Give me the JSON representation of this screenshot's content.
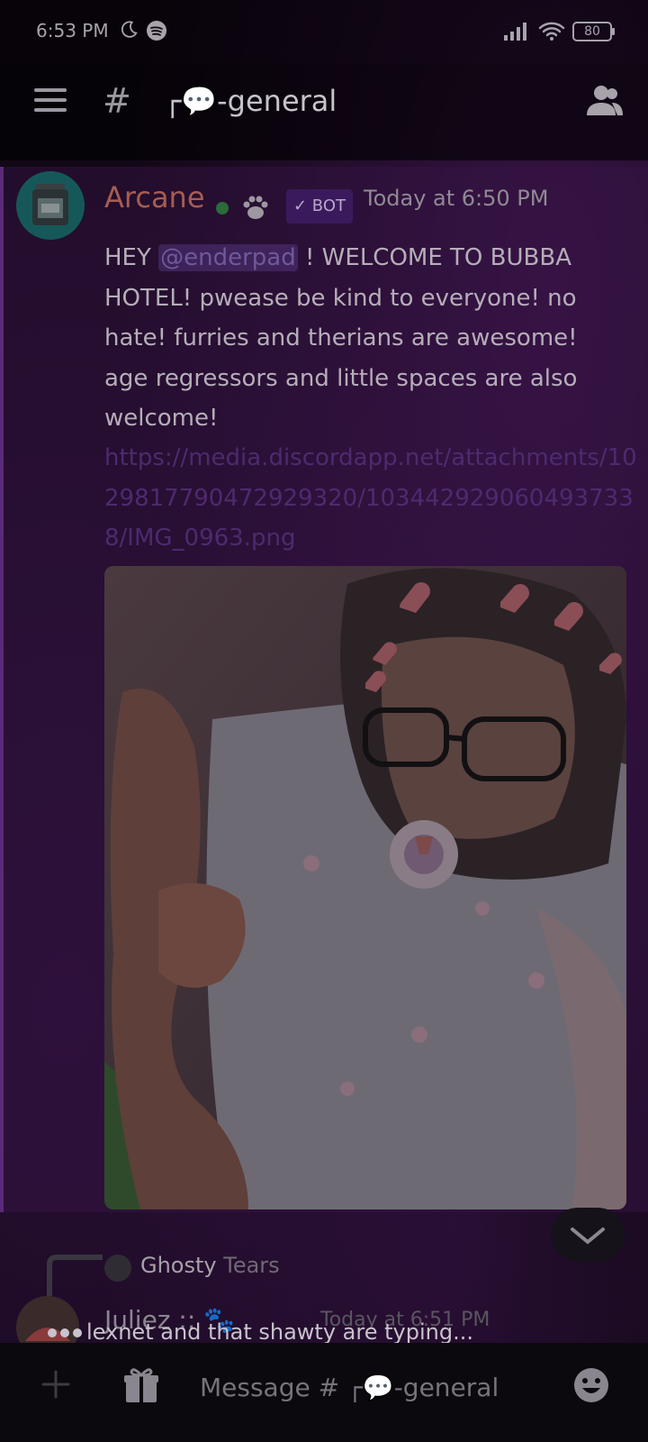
{
  "status_bar": {
    "time": "6:53 PM",
    "battery": "80",
    "icons": [
      "moon-icon",
      "spotify-icon",
      "signal-icon",
      "wifi-icon",
      "battery-icon"
    ]
  },
  "header": {
    "channel_name": "┌💬-general",
    "icons": [
      "menu-icon",
      "hash-icon",
      "members-icon"
    ]
  },
  "message": {
    "author": "Arcane",
    "bot_badge": "✓ BOT",
    "timestamp": "Today at 6:50 PM",
    "text_before": "HEY ",
    "mention": "@enderpad",
    "text_after": " ! WELCOME TO BUBBA HOTEL! pwease be kind to everyone! no hate! furries and therians are awesome! age regressors and little spaces are also welcome!",
    "link": "https://media.discordapp.net/attachments/1029817790472929320/1034429290604937338/IMG_0963.png"
  },
  "reply_preview": {
    "name": "Ghosty",
    "suffix": "Tears"
  },
  "next_message": {
    "author": "Juliez :: 🐾",
    "timestamp": "Today at 6:51 PM"
  },
  "typing": {
    "text": "lexnet and that shawty are typing..."
  },
  "composer": {
    "placeholder": "Message # ┌💬-general"
  },
  "colors": {
    "accent": "#5b2a78",
    "author": "#a65d52",
    "online": "#2b6a3a",
    "bot_badge": "#3a1a5c",
    "link": "#4e2a6e"
  }
}
